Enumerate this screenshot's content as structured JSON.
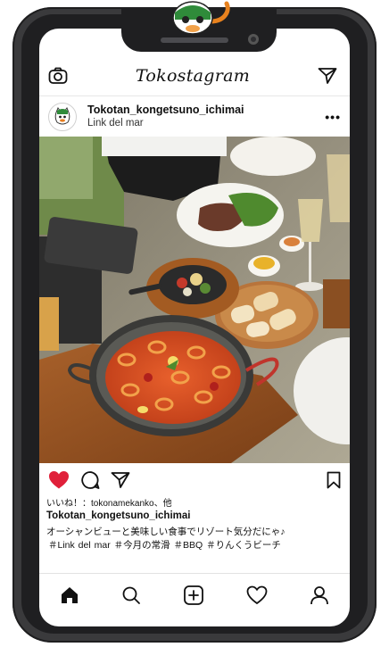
{
  "app": {
    "title": "Tokostagram"
  },
  "post": {
    "username": "Tokotan_kongetsuno_ichimai",
    "location": "Link del mar",
    "more_label": "•••",
    "likes_text": "いいね！：tokonamekanko、他",
    "caption_user": "Tokotan_kongetsuno_ichimai",
    "caption_text": "オーシャンビューと美味しい食事でリゾート気分だにゃ♪",
    "hashtags": "＃Link del mar ＃今月の常滑 ＃BBQ ＃りんくうビーチ",
    "liked": true
  },
  "icons": {
    "top_left": "camera-icon",
    "top_right": "send-icon",
    "like": "heart-icon",
    "comment": "comment-icon",
    "share": "send-icon",
    "save": "bookmark-icon",
    "nav": [
      "home-icon",
      "search-icon",
      "add-post-icon",
      "heart-outline-icon",
      "profile-icon"
    ]
  },
  "colors": {
    "like": "#e0203a",
    "phone_frame": "#3a3a3c",
    "text": "#111111"
  }
}
